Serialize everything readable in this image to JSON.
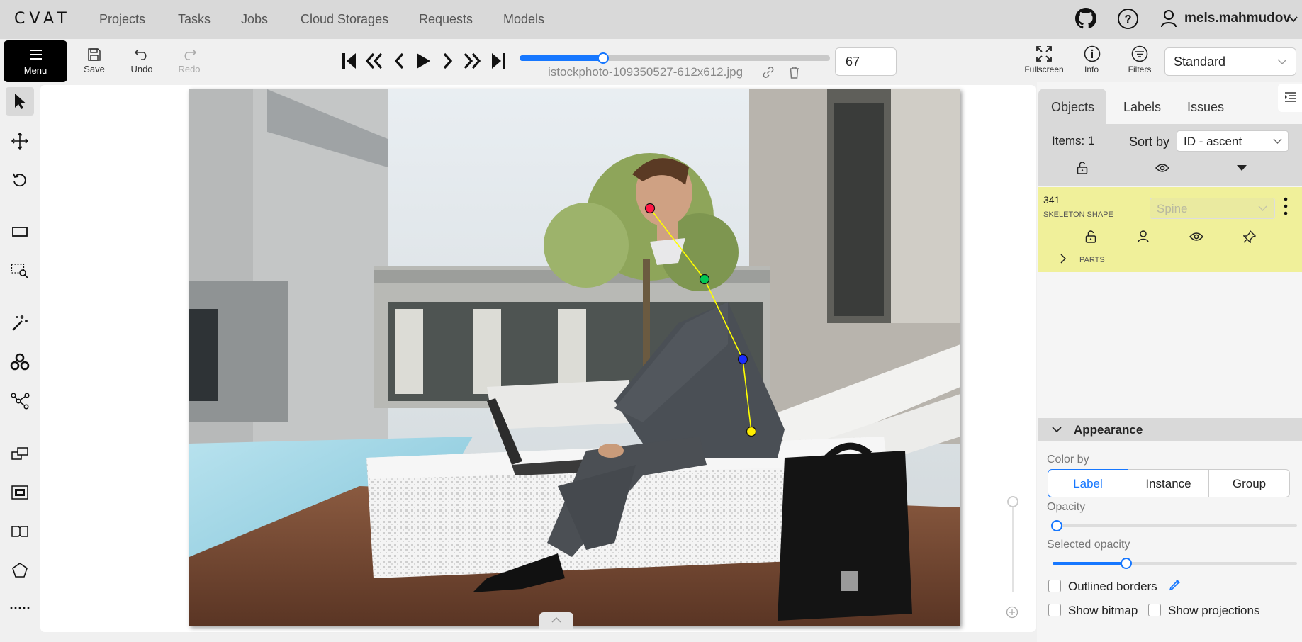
{
  "nav": {
    "logo": "CVAT",
    "links": [
      "Projects",
      "Tasks",
      "Jobs",
      "Cloud Storages",
      "Requests",
      "Models"
    ],
    "username": "mels.mahmudov"
  },
  "toolbar": {
    "menu_label": "Menu",
    "save_label": "Save",
    "undo_label": "Undo",
    "redo_label": "Redo",
    "frame_number": "67",
    "frame_progress": 0.27,
    "filename": "istockphoto-109350527-612x612.jpg",
    "fullscreen_label": "Fullscreen",
    "info_label": "Info",
    "filters_label": "Filters",
    "workspace": "Standard"
  },
  "sidebar_tools": [
    "cursor-icon",
    "move-icon",
    "rotate-icon",
    "rectangle-icon",
    "zoom-region-icon",
    "magic-wand-icon",
    "ai-tools-icon",
    "skeleton-icon",
    "group-icon",
    "merge-icon",
    "split-icon",
    "polygon-icon",
    "more-icon"
  ],
  "objects_panel": {
    "tabs": [
      "Objects",
      "Labels",
      "Issues"
    ],
    "items_count": "Items: 1",
    "sort_label": "Sort by",
    "sort_value": "ID - ascent",
    "object": {
      "id": "341",
      "type": "SKELETON SHAPE",
      "label": "Spine",
      "parts_label": "PARTS"
    }
  },
  "appearance": {
    "title": "Appearance",
    "color_by_label": "Color by",
    "color_by_options": [
      "Label",
      "Instance",
      "Group"
    ],
    "color_by_selected": "Label",
    "opacity_label": "Opacity",
    "opacity_value": 0,
    "selected_opacity_label": "Selected opacity",
    "selected_opacity_value": 0.3,
    "outlined_borders_label": "Outlined borders",
    "show_bitmap_label": "Show bitmap",
    "show_projections_label": "Show projections"
  },
  "colors": {
    "accent": "#1677ff",
    "object_card": "#f0f09a",
    "skeleton_line": "#ffff00",
    "point_head": "#ff1744",
    "point_shoulder": "#00c853",
    "point_mid": "#1a2cff",
    "point_hip": "#ffee00"
  }
}
